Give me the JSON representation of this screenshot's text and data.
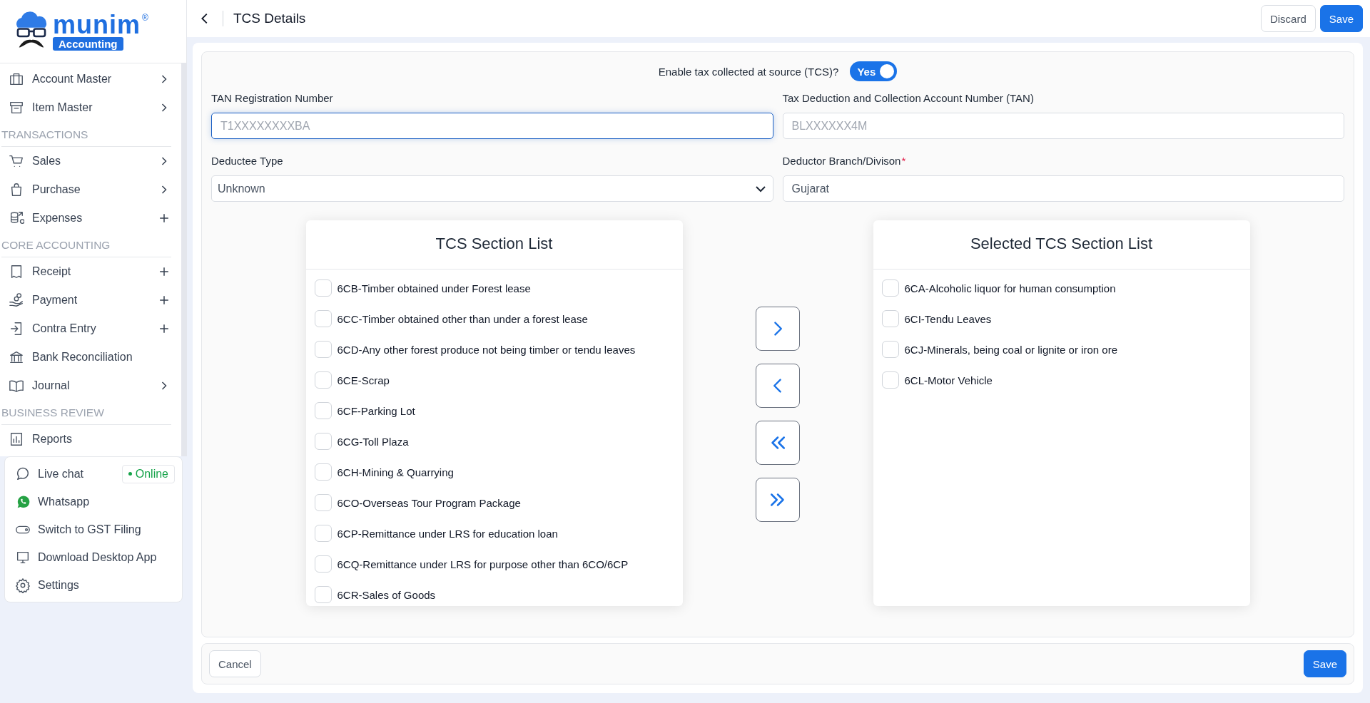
{
  "logo": {
    "brand": "munim",
    "badge": "Accounting",
    "mark": "®"
  },
  "sidebar": {
    "items": [
      {
        "kind": "submenu",
        "label": "Account Master"
      },
      {
        "kind": "submenu",
        "label": "Item Master"
      },
      {
        "kind": "heading",
        "label": "TRANSACTIONS"
      },
      {
        "kind": "submenu",
        "label": "Sales"
      },
      {
        "kind": "submenu",
        "label": "Purchase"
      },
      {
        "kind": "addable",
        "label": "Expenses"
      },
      {
        "kind": "heading",
        "label": "CORE ACCOUNTING"
      },
      {
        "kind": "addable",
        "label": "Receipt"
      },
      {
        "kind": "addable",
        "label": "Payment"
      },
      {
        "kind": "addable",
        "label": "Contra Entry"
      },
      {
        "kind": "plain",
        "label": "Bank Reconciliation"
      },
      {
        "kind": "submenu",
        "label": "Journal"
      },
      {
        "kind": "heading",
        "label": "BUSINESS REVIEW"
      },
      {
        "kind": "plain",
        "label": "Reports"
      }
    ]
  },
  "support": {
    "items": [
      {
        "label": "Live chat",
        "badge": "Online"
      },
      {
        "label": "Whatsapp"
      },
      {
        "label": "Switch to GST Filing"
      },
      {
        "label": "Download Desktop App"
      },
      {
        "label": "Settings"
      }
    ]
  },
  "header": {
    "title": "TCS Details",
    "buttons": [
      {
        "label": "Discard",
        "kind": "secondary"
      },
      {
        "label": "Save",
        "kind": "primary"
      }
    ]
  },
  "tcs_toggle": {
    "label": "Enable tax collected at source (TCS)?",
    "text": "Yes",
    "on": true
  },
  "fields": [
    {
      "label": "TAN Registration Number",
      "kind": "text",
      "placeholder": "T1XXXXXXXXBA",
      "focused": true
    },
    {
      "label": "Tax Deduction and Collection Account Number (TAN)",
      "kind": "text",
      "placeholder": "BLXXXXXX4M",
      "focused": false
    },
    {
      "label": "Deductee Type",
      "kind": "select",
      "value": "Unknown",
      "focused": false
    },
    {
      "label": "Deductor Branch/Divison",
      "kind": "text",
      "value": "Gujarat",
      "focused": false,
      "required_mark": "*"
    }
  ],
  "lists": [
    {
      "title": "TCS Section List",
      "items": [
        {
          "label": "6CB-Timber obtained under Forest lease",
          "checked": false
        },
        {
          "label": "6CC-Timber obtained other than under a forest lease",
          "checked": false
        },
        {
          "label": "6CD-Any other forest produce not being timber or tendu leaves",
          "checked": false
        },
        {
          "label": "6CE-Scrap",
          "checked": false
        },
        {
          "label": "6CF-Parking Lot",
          "checked": false
        },
        {
          "label": "6CG-Toll Plaza",
          "checked": false
        },
        {
          "label": "6CH-Mining & Quarrying",
          "checked": false
        },
        {
          "label": "6CO-Overseas Tour Program Package",
          "checked": false
        },
        {
          "label": "6CP-Remittance under LRS for education loan",
          "checked": false
        },
        {
          "label": "6CQ-Remittance under LRS for purpose other than 6CO/6CP",
          "checked": false
        },
        {
          "label": "6CR-Sales of Goods",
          "checked": false
        }
      ]
    },
    {
      "title": "Selected TCS Section List",
      "items": [
        {
          "label": "6CA-Alcoholic liquor for human consumption",
          "checked": false
        },
        {
          "label": "6CI-Tendu Leaves",
          "checked": false
        },
        {
          "label": "6CJ-Minerals, being coal or lignite or iron ore",
          "checked": false
        },
        {
          "label": "6CL-Motor Vehicle",
          "checked": false
        }
      ]
    }
  ],
  "footer": {
    "buttons": [
      {
        "label": "Cancel",
        "kind": "secondary"
      },
      {
        "label": "Save",
        "kind": "primary"
      }
    ]
  }
}
